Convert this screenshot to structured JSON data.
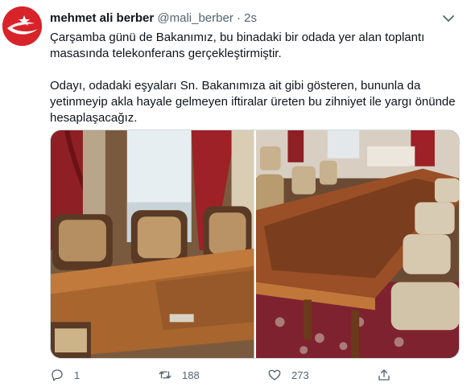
{
  "tweet": {
    "display_name": "mehmet ali berber",
    "handle": "@mali_berber",
    "separator": "·",
    "time": "2s",
    "paragraphs": [
      "Çarşamba günü de Bakanımız, bu binadaki bir odada yer alan toplantı masasında telekonferans gerçekleştirmiştir.",
      "Odayı, odadaki eşyaları Sn. Bakanımıza ait gibi gösteren, bununla da yetinmeyip akla hayale gelmeyen iftiralar üreten bu zihniyet ile yargı önünde hesaplaşacağız."
    ]
  },
  "actions": {
    "reply_count": "1",
    "retweet_count": "188",
    "like_count": "273"
  },
  "icons": {
    "avatar": "crescent-star-logo",
    "caret": "chevron-down-icon",
    "reply": "reply-icon",
    "retweet": "retweet-icon",
    "like": "heart-icon",
    "share": "share-icon"
  },
  "colors": {
    "avatar_red": "#d8232a",
    "muted_text": "#536471",
    "text": "#0f1419"
  }
}
